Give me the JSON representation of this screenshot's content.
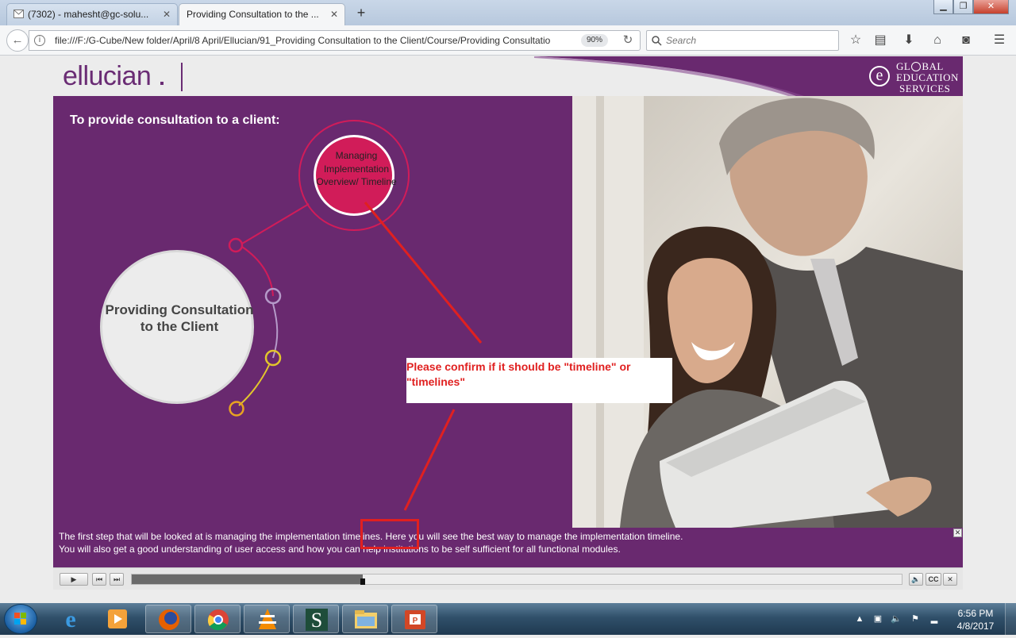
{
  "browser": {
    "tabs": [
      {
        "label": "(7302) - mahesht@gc-solu...",
        "active": false,
        "icon": "mail-icon"
      },
      {
        "label": "Providing Consultation to the ...",
        "active": true,
        "icon": "none"
      }
    ],
    "url": "file:///F:/G-Cube/New folder/April/8 April/Ellucian/91_Providing Consultation to the Client/Course/Providing Consultatio",
    "zoom": "90%",
    "search_placeholder": "Search",
    "window_buttons": [
      "minimize",
      "restore",
      "close"
    ],
    "toolbar_icons": [
      "star-icon",
      "reader-icon",
      "download-icon",
      "home-icon",
      "pocket-icon",
      "menu-icon"
    ]
  },
  "course": {
    "logo": "ellucian",
    "partner_logo": [
      "GL",
      "BAL",
      "EDUCATION",
      "SERVICES"
    ],
    "heading": "To provide consultation to a client:",
    "main_topic": "Providing Consultation to the Client",
    "active_topic": "Managing Implementation Overview/ Timeline",
    "node_colors": [
      "#d11c59",
      "#b59ac9",
      "#e2c62c",
      "#e8a321"
    ],
    "caption": {
      "line1": "The first step that will be looked at is managing the implementation timelines. Here you will see the best way to manage the implementation timeline.",
      "line2": "You will also get a good understanding of user access and how you can help institutions to be self sufficient for all functional modules."
    },
    "player": {
      "progress": 0.3,
      "buttons": [
        "play",
        "rewind",
        "forward"
      ],
      "right_buttons": [
        "volume",
        "CC",
        "close"
      ]
    }
  },
  "annotation": {
    "comment": "Please confirm if it should be \"timeline\" or \"timelines\"",
    "color": "#e02020"
  },
  "taskbar": {
    "apps": [
      "internet-explorer-icon",
      "media-player-icon",
      "firefox-icon",
      "chrome-icon",
      "vlc-icon",
      "app-s-icon",
      "file-explorer-icon",
      "powerpoint-icon"
    ],
    "time": "6:56 PM",
    "date": "4/8/2017"
  }
}
